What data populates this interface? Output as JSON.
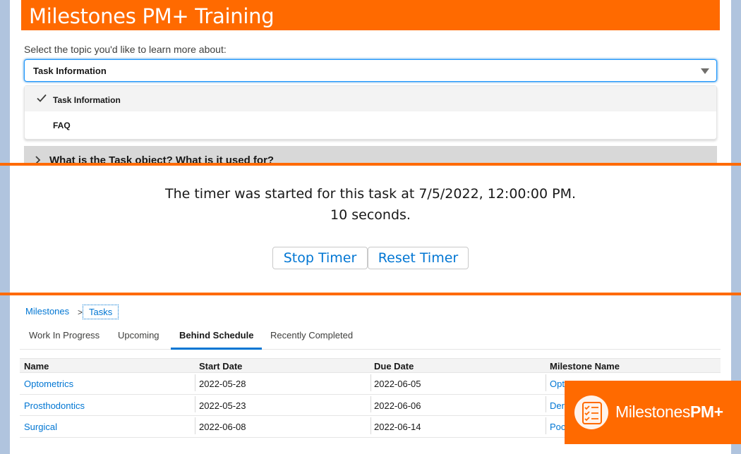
{
  "training": {
    "title": "Milestones PM+ Training",
    "select_label": "Select the topic you'd like to learn more about:",
    "selected_value": "Task Information",
    "options": [
      "Task Information",
      "FAQ"
    ],
    "accordion_title": "What is the Task object? What is it used for?"
  },
  "timer": {
    "line1": "The timer was started for this task at 7/5/2022, 12:00:00 PM.",
    "line2": "10 seconds.",
    "stop_label": "Stop Timer",
    "reset_label": "Reset Timer"
  },
  "tasks": {
    "breadcrumb": [
      "Milestones",
      "Tasks"
    ],
    "breadcrumb_separator": ">",
    "tabs": [
      "Work In Progress",
      "Upcoming",
      "Behind Schedule",
      "Recently Completed"
    ],
    "active_tab": "Behind Schedule",
    "columns": [
      "Name",
      "Start Date",
      "Due Date",
      "Milestone Name"
    ],
    "rows": [
      {
        "name": "Optometrics",
        "start": "2022-05-28",
        "due": "2022-06-05",
        "milestone": "Opt"
      },
      {
        "name": "Prosthodontics",
        "start": "2022-05-23",
        "due": "2022-06-06",
        "milestone": "Der"
      },
      {
        "name": "Surgical",
        "start": "2022-06-08",
        "due": "2022-06-14",
        "milestone": "Poc"
      }
    ]
  },
  "logo": {
    "text_regular": "Milestones",
    "text_bold": "PM+",
    "icon": "checklist-icon"
  },
  "colors": {
    "brand_orange": "#ff6a00",
    "link_blue": "#0176d3",
    "page_background": "#b0c4de"
  }
}
